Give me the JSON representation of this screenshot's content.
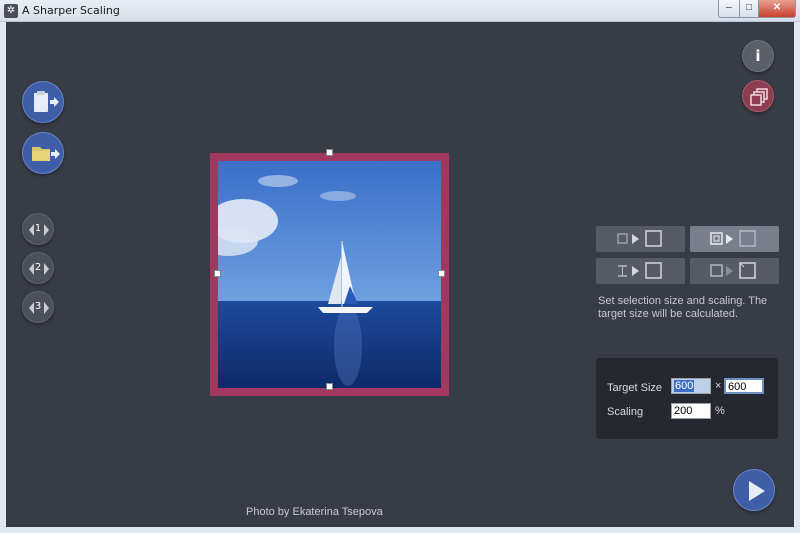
{
  "window": {
    "title": "A Sharper Scaling",
    "minimize_glyph": "–",
    "maximize_glyph": "□",
    "close_glyph": "✕"
  },
  "sidebar": {
    "clipboard_icon": "clipboard-paste-icon",
    "folder_icon": "folder-open-icon",
    "presets": [
      "1",
      "2",
      "3"
    ]
  },
  "top_right": {
    "info_glyph": "i",
    "copy_icon": "copy-stack-icon"
  },
  "photo": {
    "credit": "Photo by Ekaterina Tsepova"
  },
  "modes": {
    "hint": "Set selection size and scaling. The target size will be calculated."
  },
  "settings": {
    "target_size_label": "Target Size",
    "target_width": "600",
    "times": "×",
    "target_height": "600",
    "scaling_label": "Scaling",
    "scaling_value": "200",
    "percent": "%"
  },
  "colors": {
    "background": "#383c47",
    "accent_blue": "#3f5ea8",
    "selection_border": "#a0385f",
    "panel": "#262830"
  }
}
